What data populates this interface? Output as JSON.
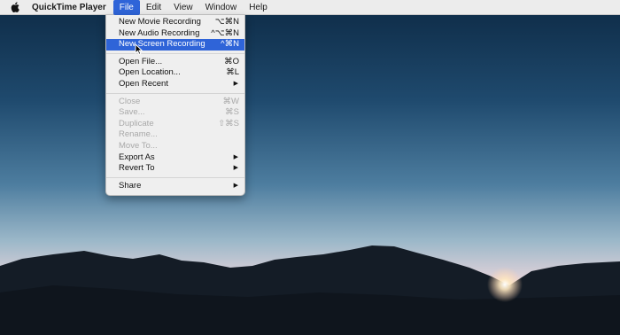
{
  "menubar": {
    "apple_icon": "apple-logo-icon",
    "app_name": "QuickTime Player",
    "items": [
      "File",
      "Edit",
      "View",
      "Window",
      "Help"
    ],
    "active": "File"
  },
  "file_menu": {
    "recording": [
      {
        "label": "New Movie Recording",
        "shortcut": "⌥⌘N"
      },
      {
        "label": "New Audio Recording",
        "shortcut": "^⌥⌘N"
      },
      {
        "label": "New Screen Recording",
        "shortcut": "^⌘N",
        "highlighted": true
      }
    ],
    "open": [
      {
        "label": "Open File...",
        "shortcut": "⌘O"
      },
      {
        "label": "Open Location...",
        "shortcut": "⌘L"
      },
      {
        "label": "Open Recent",
        "submenu": "▶"
      }
    ],
    "file_ops": [
      {
        "label": "Close",
        "shortcut": "⌘W",
        "disabled": true
      },
      {
        "label": "Save...",
        "shortcut": "⌘S",
        "disabled": true
      },
      {
        "label": "Duplicate",
        "shortcut": "⇧⌘S",
        "disabled": true
      },
      {
        "label": "Rename...",
        "disabled": true
      },
      {
        "label": "Move To...",
        "disabled": true
      },
      {
        "label": "Export As",
        "submenu": "▶"
      },
      {
        "label": "Revert To",
        "submenu": "▶"
      }
    ],
    "share": [
      {
        "label": "Share",
        "submenu": "▶"
      }
    ]
  },
  "colors": {
    "menu_highlight": "#2f64d8",
    "sky_top": "#0d2a45",
    "sky_bottom": "#f3d8dc"
  }
}
